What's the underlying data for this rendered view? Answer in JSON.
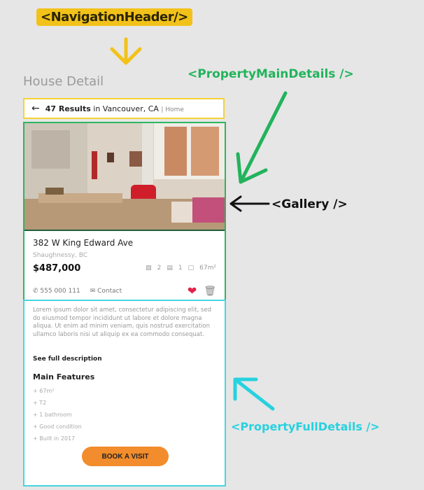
{
  "annotations": {
    "navigation_header": "<NavigationHeader/>",
    "property_main_details": "<PropertyMainDetails />",
    "gallery": "<Gallery />",
    "property_full_details": "<PropertyFullDetails />"
  },
  "page_title": "House Detail",
  "nav": {
    "count": "47 Results",
    "location": "in Vancouver, CA",
    "crumb": "| Home"
  },
  "property": {
    "address": "382 W King Edward Ave",
    "subtitle": "Shaughnessy, BC",
    "price": "$487,000",
    "beds": "2",
    "baths": "1",
    "area": "67m²",
    "phone": "555 000 111",
    "contact": "Contact"
  },
  "details": {
    "description": "Lorem ipsum dolor sit amet, consectetur adipiscing elit, sed do eiusmod tempor incididunt ut labore et dolore magna aliqua. Ut enim ad minim veniam, quis nostrud exercitation ullamco laboris nisi ut aliquip ex ea commodo consequat.",
    "see_full": "See full description",
    "features_title": "Main Features",
    "features": [
      "+ 67m²",
      "+ T2",
      "+ 1 bathroom",
      "+ Good condition",
      "+ Built in 2017"
    ],
    "cta": "BOOK A VISIT"
  },
  "colors": {
    "nav_border": "#f4d335",
    "main_border": "#2db661",
    "full_border": "#45d6e2",
    "accent_orange": "#f28c2c",
    "heart": "#e5204a"
  }
}
